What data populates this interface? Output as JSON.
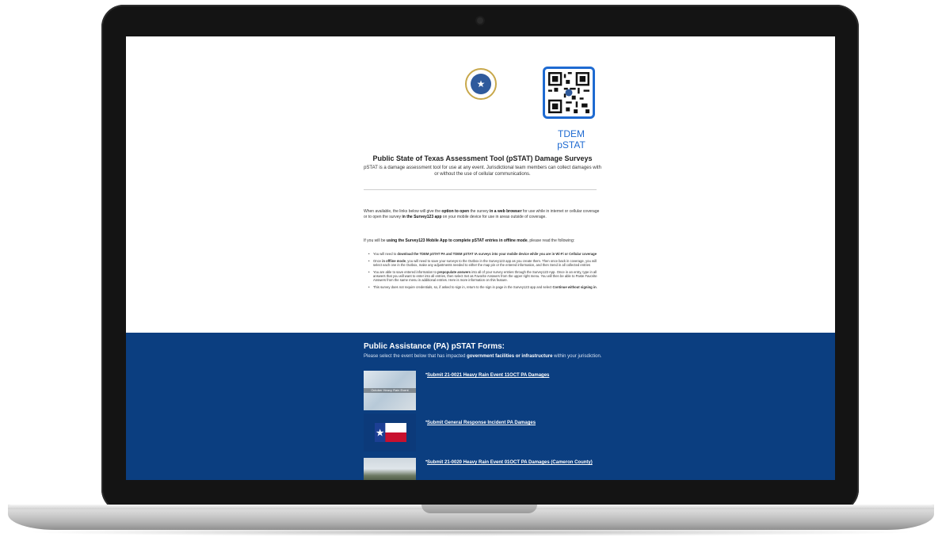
{
  "qr": {
    "label": "TDEM pSTAT"
  },
  "header": {
    "title": "Public State of Texas Assessment Tool (pSTAT) Damage Surveys",
    "subtitle": "pSTAT is a damage assessment tool for use at any event. Jurisdictional team members can collect damages with or without the use of cellular communications."
  },
  "intro": {
    "p1_a": "When available, the links below will give the ",
    "p1_b": "option to open",
    "p1_c": " the survey ",
    "p1_d": "in a web browser",
    "p1_e": " for use while in internet or cellular coverage or to open the survey ",
    "p1_f": "in the Survey123 app",
    "p1_g": " on your mobile device for use in areas outside of coverage.",
    "p2_a": "If you will be ",
    "p2_b": "using the Survey123 Mobile App to complete pSTAT entries in offline mode",
    "p2_c": ", please read the following:"
  },
  "bullets": [
    {
      "a": "You will need to ",
      "b": "download the TDEM pSTAT PA and TDEM pSTAT IA surveys into your mobile device while you are in Wi-Fi or Cellular coverage",
      "c": ""
    },
    {
      "a": "Once ",
      "b": "in offline mode",
      "c": ", you will need to save your surveys to the Outbox in the Survey123 app as you create them. Then once back in coverage, you will select each one in the Outbox, make any adjustments needed to either the map pin or the entered information, and then Send in all collected entries"
    },
    {
      "a": "You are able to save entered information to ",
      "b": "prepopulate answers",
      "c": " into all of your survey entries through the Survey123 App. Once in an entry, type in all answers that you will want to enter into all entries, then select Set as Favorite Answers from the upper right menu. You will then be able to Paste Favorite Answers from the same menu in additional entries. Here is more information on this feature."
    },
    {
      "a": "This survey does not require credentials, so, if asked to sign in, return to the sign in page in the Survey123 app and select ",
      "b": "Continue without signing in",
      "c": "."
    }
  ],
  "pa": {
    "title": "Public Assistance (PA) pSTAT Forms:",
    "desc_a": "Please select the event below that has impacted ",
    "desc_b": "government facilities or infrastructure",
    "desc_c": " within your jurisdiction.",
    "items": [
      {
        "thumb_label": "October Heavy Rain Event",
        "link": "Submit 21-0021 Heavy Rain Event 11OCT PA Damages"
      },
      {
        "link": "Submit General Response Incident PA Damages"
      },
      {
        "link": "Submit 21-0020 Heavy Rain Event 01OCT PA Damages (Cameron County)"
      }
    ]
  },
  "colors": {
    "accent": "#1e6ad1",
    "section_blue": "#0b3e80"
  }
}
